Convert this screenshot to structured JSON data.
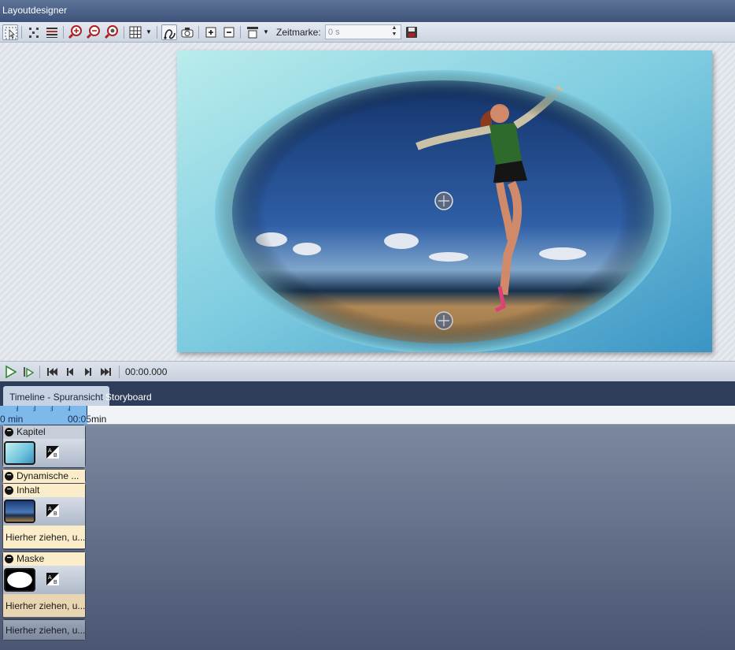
{
  "window": {
    "title": "Layoutdesigner"
  },
  "toolbar": {
    "icons": [
      "select-icon",
      "points-icon",
      "lines-icon",
      "zoom-in-icon",
      "zoom-out-icon",
      "zoom-fit-icon",
      "grid-icon",
      "dropdown-arrow-icon",
      "path-icon",
      "camera-icon",
      "add-icon",
      "remove-icon",
      "align-icon",
      "dropdown-arrow-icon",
      "save-icon"
    ],
    "zeitmarke_label": "Zeitmarke:",
    "zeitmarke_value": "0 s"
  },
  "playback": {
    "timecode": "00:00.000"
  },
  "tabs": [
    {
      "label": "Timeline - Spuransicht",
      "active": true
    },
    {
      "label": "Storyboard",
      "active": false
    }
  ],
  "ruler": {
    "start": "0 min",
    "end": "00:05",
    "unit": "min",
    "ticks": [
      "1",
      "2",
      "3",
      "4"
    ]
  },
  "tracks": {
    "kapitel": {
      "label": "Kapitel"
    },
    "dynamische": {
      "label": "Dynamische ..."
    },
    "inhalt": {
      "label": "Inhalt",
      "drop": "Hierher ziehen, u..."
    },
    "maske": {
      "label": "Maske",
      "drop": "Hierher ziehen, u..."
    },
    "bottom_drop": "Hierher ziehen, u..."
  },
  "colors": {
    "title_bar": "#4a6088",
    "tab_bar": "#2e3d5a",
    "ruler_selection": "#6aaeea",
    "track_header_yellow": "#fbedc9"
  }
}
